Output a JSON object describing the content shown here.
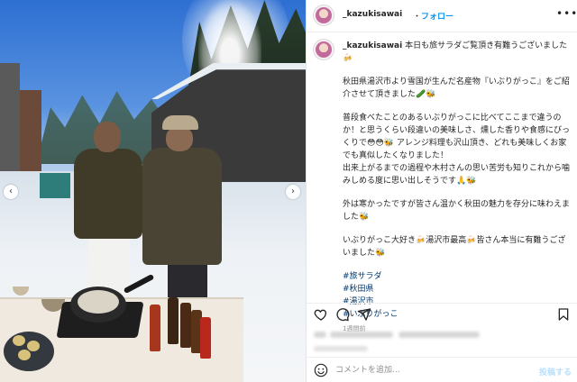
{
  "header": {
    "username": "_kazukisawai",
    "dot": "・",
    "follow_label": "フォロー",
    "more_label": "•••"
  },
  "caption": {
    "username": "_kazukisawai",
    "intro": "本日も旅サラダご覧頂き有難うございました🍻",
    "para1": "秋田県湯沢市より雪国が生んだ名産物『いぶりがっこ』をご紹介させて頂きました🥒🐝",
    "para2": "普段食べたことのあるいぶりがっこに比べてここまで違うのか！と思うくらい段違いの美味しさ、燻した香りや食感にびっくりで😳😳🐝 アレンジ料理も沢山頂き、どれも美味しくお家でも真似したくなりました！\n出来上がるまでの過程や木村さんの思い苦労も知りこれから噛みしめる度に思い出しそうです🙏🐝",
    "para3": "外は寒かったですが皆さん温かく秋田の魅力を存分に味わえました🐝",
    "para4": "いぶりがっこ大好き🍻湯沢市最高🍻皆さん本当に有難うございました🐝",
    "hashtags": [
      "#旅サラダ",
      "#秋田県",
      "#湯沢市",
      "#いぶりがっこ"
    ],
    "time": "1週間前"
  },
  "actions": {
    "like_icon": "heart-icon",
    "comment_icon": "comment-icon",
    "share_icon": "share-icon",
    "save_icon": "bookmark-icon"
  },
  "comment": {
    "placeholder": "コメントを追加...",
    "post_label": "投稿する"
  },
  "nav": {
    "prev_label": "‹",
    "next_label": "›"
  },
  "colors": {
    "follow": "#0095f6",
    "hashtag": "#00376b",
    "post_disabled": "#b9dffc"
  }
}
